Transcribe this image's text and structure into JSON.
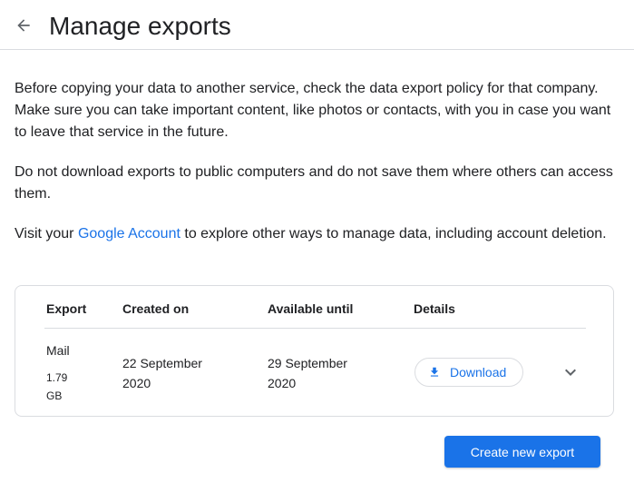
{
  "header": {
    "title": "Manage exports",
    "back_icon": "arrow-back-icon"
  },
  "intro": {
    "p1": "Before copying your data to another service, check the data export policy for that company. Make sure you can take important content, like photos or contacts, with you in case you want to leave that service in the future.",
    "p2": "Do not download exports to public computers and do not save them where others can access them.",
    "p3_before": "Visit your ",
    "p3_link": "Google Account",
    "p3_after": " to explore other ways to manage data, including account deletion."
  },
  "table": {
    "headers": {
      "export": "Export",
      "created": "Created on",
      "available": "Available until",
      "details": "Details"
    },
    "rows": [
      {
        "name": "Mail",
        "size": "1.79 GB",
        "created": "22 September 2020",
        "available": "29 September 2020",
        "download_label": "Download",
        "download_icon": "download-icon",
        "expand_icon": "chevron-down-icon"
      }
    ]
  },
  "actions": {
    "create_label": "Create new export"
  },
  "colors": {
    "accent": "#1a73e8",
    "border": "#dadce0",
    "text": "#202124"
  }
}
